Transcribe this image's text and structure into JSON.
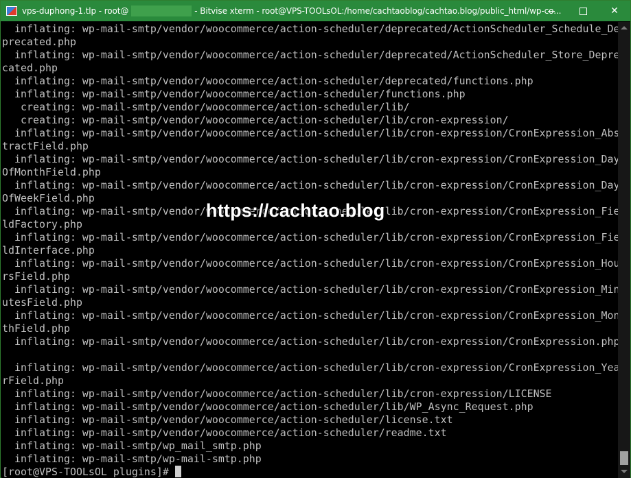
{
  "window": {
    "title_prefix": "vps-duphong-1.tlp - root@",
    "title_suffix": " - Bitvise xterm - root@VPS-TOOLsOL:/home/cachtaoblog/cachtao.blog/public_html/wp-co...",
    "buttons": {
      "minimize_icon": "minimize-icon",
      "maximize_icon": "maximize-icon",
      "close_icon": "close-icon",
      "close_glyph": "✕"
    },
    "accent_color": "#2a8a3c"
  },
  "terminal": {
    "lines": [
      "  inflating: wp-mail-smtp/vendor/woocommerce/action-scheduler/deprecated/ActionScheduler_Schedule_De",
      "precated.php",
      "  inflating: wp-mail-smtp/vendor/woocommerce/action-scheduler/deprecated/ActionScheduler_Store_Depre",
      "cated.php",
      "  inflating: wp-mail-smtp/vendor/woocommerce/action-scheduler/deprecated/functions.php",
      "  inflating: wp-mail-smtp/vendor/woocommerce/action-scheduler/functions.php",
      "   creating: wp-mail-smtp/vendor/woocommerce/action-scheduler/lib/",
      "   creating: wp-mail-smtp/vendor/woocommerce/action-scheduler/lib/cron-expression/",
      "  inflating: wp-mail-smtp/vendor/woocommerce/action-scheduler/lib/cron-expression/CronExpression_Abs",
      "tractField.php",
      "  inflating: wp-mail-smtp/vendor/woocommerce/action-scheduler/lib/cron-expression/CronExpression_Day",
      "OfMonthField.php",
      "  inflating: wp-mail-smtp/vendor/woocommerce/action-scheduler/lib/cron-expression/CronExpression_Day",
      "OfWeekField.php",
      "  inflating: wp-mail-smtp/vendor/woocommerce/action-scheduler/lib/cron-expression/CronExpression_Fie",
      "ldFactory.php",
      "  inflating: wp-mail-smtp/vendor/woocommerce/action-scheduler/lib/cron-expression/CronExpression_Fie",
      "ldInterface.php",
      "  inflating: wp-mail-smtp/vendor/woocommerce/action-scheduler/lib/cron-expression/CronExpression_Hou",
      "rsField.php",
      "  inflating: wp-mail-smtp/vendor/woocommerce/action-scheduler/lib/cron-expression/CronExpression_Min",
      "utesField.php",
      "  inflating: wp-mail-smtp/vendor/woocommerce/action-scheduler/lib/cron-expression/CronExpression_Mon",
      "thField.php",
      "  inflating: wp-mail-smtp/vendor/woocommerce/action-scheduler/lib/cron-expression/CronExpression.php",
      "",
      "  inflating: wp-mail-smtp/vendor/woocommerce/action-scheduler/lib/cron-expression/CronExpression_Yea",
      "rField.php",
      "  inflating: wp-mail-smtp/vendor/woocommerce/action-scheduler/lib/cron-expression/LICENSE",
      "  inflating: wp-mail-smtp/vendor/woocommerce/action-scheduler/lib/WP_Async_Request.php",
      "  inflating: wp-mail-smtp/vendor/woocommerce/action-scheduler/license.txt",
      "  inflating: wp-mail-smtp/vendor/woocommerce/action-scheduler/readme.txt",
      "  inflating: wp-mail-smtp/wp_mail_smtp.php",
      "  inflating: wp-mail-smtp/wp-mail-smtp.php"
    ],
    "prompt": "[root@VPS-TOOLsOL plugins]# ",
    "text_color": "#c0c0c0",
    "background": "#000000"
  },
  "watermark": {
    "text": "https://cachtao.blog"
  }
}
